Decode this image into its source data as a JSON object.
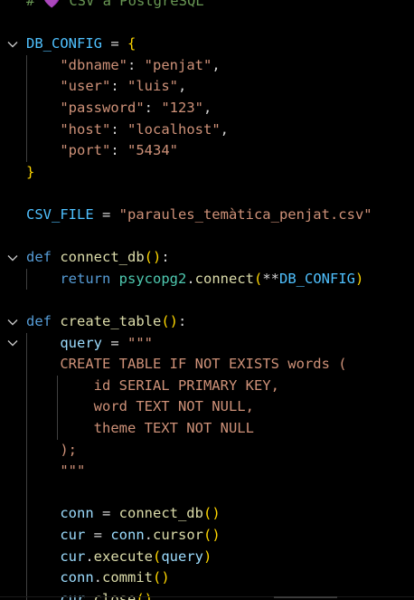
{
  "colors": {
    "comment": "#6a9955",
    "keyword": "#569cd6",
    "function": "#dcdcaa",
    "string": "#ce9178",
    "variable": "#9cdcfe",
    "module": "#4ec9b0",
    "constant": "#4fc1ff",
    "bracket_gold": "#ffd700",
    "bracket_pink": "#da70d6",
    "bracket_blue": "#179fff",
    "plain": "#d4d4d4",
    "sql": "#ce9178"
  },
  "lines": [
    {
      "fold": false,
      "tokens": [
        [
          "# ",
          "comment"
        ],
        [
          "💜",
          "emoji"
        ],
        [
          " CSV a PostgreSQL",
          "comment"
        ]
      ]
    },
    {
      "fold": false,
      "tokens": []
    },
    {
      "fold": true,
      "tokens": [
        [
          "DB_CONFIG",
          "constant"
        ],
        [
          " = ",
          "plain"
        ],
        [
          "{",
          "bracket_gold"
        ]
      ]
    },
    {
      "fold": false,
      "tokens": [
        [
          "    ",
          "plain"
        ],
        [
          "\"dbname\"",
          "string"
        ],
        [
          ": ",
          "plain"
        ],
        [
          "\"penjat\"",
          "string"
        ],
        [
          ",",
          "plain"
        ]
      ]
    },
    {
      "fold": false,
      "tokens": [
        [
          "    ",
          "plain"
        ],
        [
          "\"user\"",
          "string"
        ],
        [
          ": ",
          "plain"
        ],
        [
          "\"luis\"",
          "string"
        ],
        [
          ",",
          "plain"
        ]
      ]
    },
    {
      "fold": false,
      "tokens": [
        [
          "    ",
          "plain"
        ],
        [
          "\"password\"",
          "string"
        ],
        [
          ": ",
          "plain"
        ],
        [
          "\"123\"",
          "string"
        ],
        [
          ",",
          "plain"
        ]
      ]
    },
    {
      "fold": false,
      "tokens": [
        [
          "    ",
          "plain"
        ],
        [
          "\"host\"",
          "string"
        ],
        [
          ": ",
          "plain"
        ],
        [
          "\"localhost\"",
          "string"
        ],
        [
          ",",
          "plain"
        ]
      ]
    },
    {
      "fold": false,
      "tokens": [
        [
          "    ",
          "plain"
        ],
        [
          "\"port\"",
          "string"
        ],
        [
          ": ",
          "plain"
        ],
        [
          "\"5434\"",
          "string"
        ]
      ]
    },
    {
      "fold": false,
      "tokens": [
        [
          "}",
          "bracket_gold"
        ]
      ]
    },
    {
      "fold": false,
      "tokens": []
    },
    {
      "fold": false,
      "tokens": [
        [
          "CSV_FILE",
          "constant"
        ],
        [
          " = ",
          "plain"
        ],
        [
          "\"paraules_temàtica_penjat.csv\"",
          "string"
        ]
      ]
    },
    {
      "fold": false,
      "tokens": []
    },
    {
      "fold": true,
      "tokens": [
        [
          "def",
          "keyword"
        ],
        [
          " ",
          "plain"
        ],
        [
          "connect_db",
          "function"
        ],
        [
          "()",
          "bracket_gold"
        ],
        [
          ":",
          "plain"
        ]
      ]
    },
    {
      "fold": false,
      "tokens": [
        [
          "    ",
          "plain"
        ],
        [
          "return",
          "keyword_ctrl"
        ],
        [
          " ",
          "plain"
        ],
        [
          "psycopg2",
          "module"
        ],
        [
          ".",
          "plain"
        ],
        [
          "connect",
          "function"
        ],
        [
          "(",
          "bracket_gold"
        ],
        [
          "**",
          "plain"
        ],
        [
          "DB_CONFIG",
          "constant"
        ],
        [
          ")",
          "bracket_gold"
        ]
      ]
    },
    {
      "fold": false,
      "tokens": []
    },
    {
      "fold": true,
      "tokens": [
        [
          "def",
          "keyword"
        ],
        [
          " ",
          "plain"
        ],
        [
          "create_table",
          "function"
        ],
        [
          "()",
          "bracket_gold"
        ],
        [
          ":",
          "plain"
        ]
      ]
    },
    {
      "fold": true,
      "tokens": [
        [
          "    ",
          "plain"
        ],
        [
          "query",
          "variable"
        ],
        [
          " = ",
          "plain"
        ],
        [
          "\"\"\"",
          "string"
        ]
      ]
    },
    {
      "fold": false,
      "tokens": [
        [
          "    ",
          "plain"
        ],
        [
          "CREATE TABLE IF NOT EXISTS words (",
          "sql"
        ]
      ]
    },
    {
      "fold": false,
      "tokens": [
        [
          "        ",
          "plain"
        ],
        [
          "id SERIAL PRIMARY KEY,",
          "sql"
        ]
      ]
    },
    {
      "fold": false,
      "tokens": [
        [
          "        ",
          "plain"
        ],
        [
          "word TEXT NOT NULL,",
          "sql"
        ]
      ]
    },
    {
      "fold": false,
      "tokens": [
        [
          "        ",
          "plain"
        ],
        [
          "theme TEXT NOT NULL",
          "sql"
        ]
      ]
    },
    {
      "fold": false,
      "tokens": [
        [
          "    ",
          "plain"
        ],
        [
          ");",
          "sql"
        ]
      ]
    },
    {
      "fold": false,
      "tokens": [
        [
          "    ",
          "plain"
        ],
        [
          "\"\"\"",
          "string"
        ]
      ]
    },
    {
      "fold": false,
      "tokens": []
    },
    {
      "fold": false,
      "tokens": [
        [
          "    ",
          "plain"
        ],
        [
          "conn",
          "variable"
        ],
        [
          " = ",
          "plain"
        ],
        [
          "connect_db",
          "function"
        ],
        [
          "()",
          "bracket_gold"
        ]
      ]
    },
    {
      "fold": false,
      "tokens": [
        [
          "    ",
          "plain"
        ],
        [
          "cur",
          "variable"
        ],
        [
          " = ",
          "plain"
        ],
        [
          "conn",
          "variable"
        ],
        [
          ".",
          "plain"
        ],
        [
          "cursor",
          "function"
        ],
        [
          "()",
          "bracket_gold"
        ]
      ]
    },
    {
      "fold": false,
      "tokens": [
        [
          "    ",
          "plain"
        ],
        [
          "cur",
          "variable"
        ],
        [
          ".",
          "plain"
        ],
        [
          "execute",
          "function"
        ],
        [
          "(",
          "bracket_gold"
        ],
        [
          "query",
          "variable"
        ],
        [
          ")",
          "bracket_gold"
        ]
      ]
    },
    {
      "fold": false,
      "tokens": [
        [
          "    ",
          "plain"
        ],
        [
          "conn",
          "variable"
        ],
        [
          ".",
          "plain"
        ],
        [
          "commit",
          "function"
        ],
        [
          "()",
          "bracket_gold"
        ]
      ]
    },
    {
      "fold": false,
      "tokens": [
        [
          "    ",
          "plain"
        ],
        [
          "cur",
          "variable"
        ],
        [
          ".",
          "plain"
        ],
        [
          "close",
          "function"
        ],
        [
          "()",
          "bracket_gold"
        ]
      ]
    }
  ]
}
